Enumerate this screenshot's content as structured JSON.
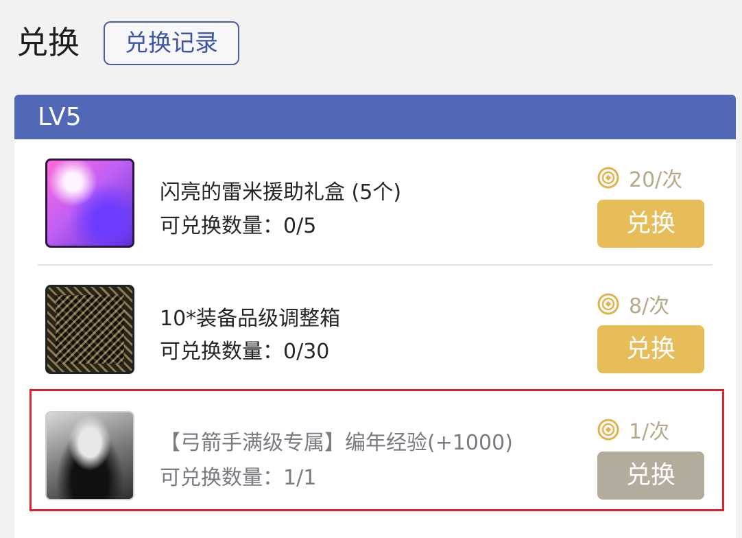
{
  "header": {
    "title": "兑换",
    "history_button": "兑换记录"
  },
  "section": {
    "level": "LV5"
  },
  "items": [
    {
      "name": "闪亮的雷米援助礼盒 (5个)",
      "quantity_label": "可兑换数量：0/5",
      "price": "20/次",
      "button": "兑换",
      "enabled": true
    },
    {
      "name": "10*装备品级调整箱",
      "quantity_label": "可兑换数量：0/30",
      "price": "8/次",
      "button": "兑换",
      "enabled": true
    },
    {
      "name": "【弓箭手满级专属】编年经验(+1000)",
      "quantity_label": "可兑换数量：1/1",
      "price": "1/次",
      "button": "兑换",
      "enabled": false
    }
  ],
  "colors": {
    "header_bar": "#5068b5",
    "button_active": "#e6bd59",
    "button_disabled": "#b3ab9b",
    "highlight_border": "#e0232a",
    "coin": "#e2b24a"
  },
  "icons": {
    "coin": "coin-icon"
  }
}
